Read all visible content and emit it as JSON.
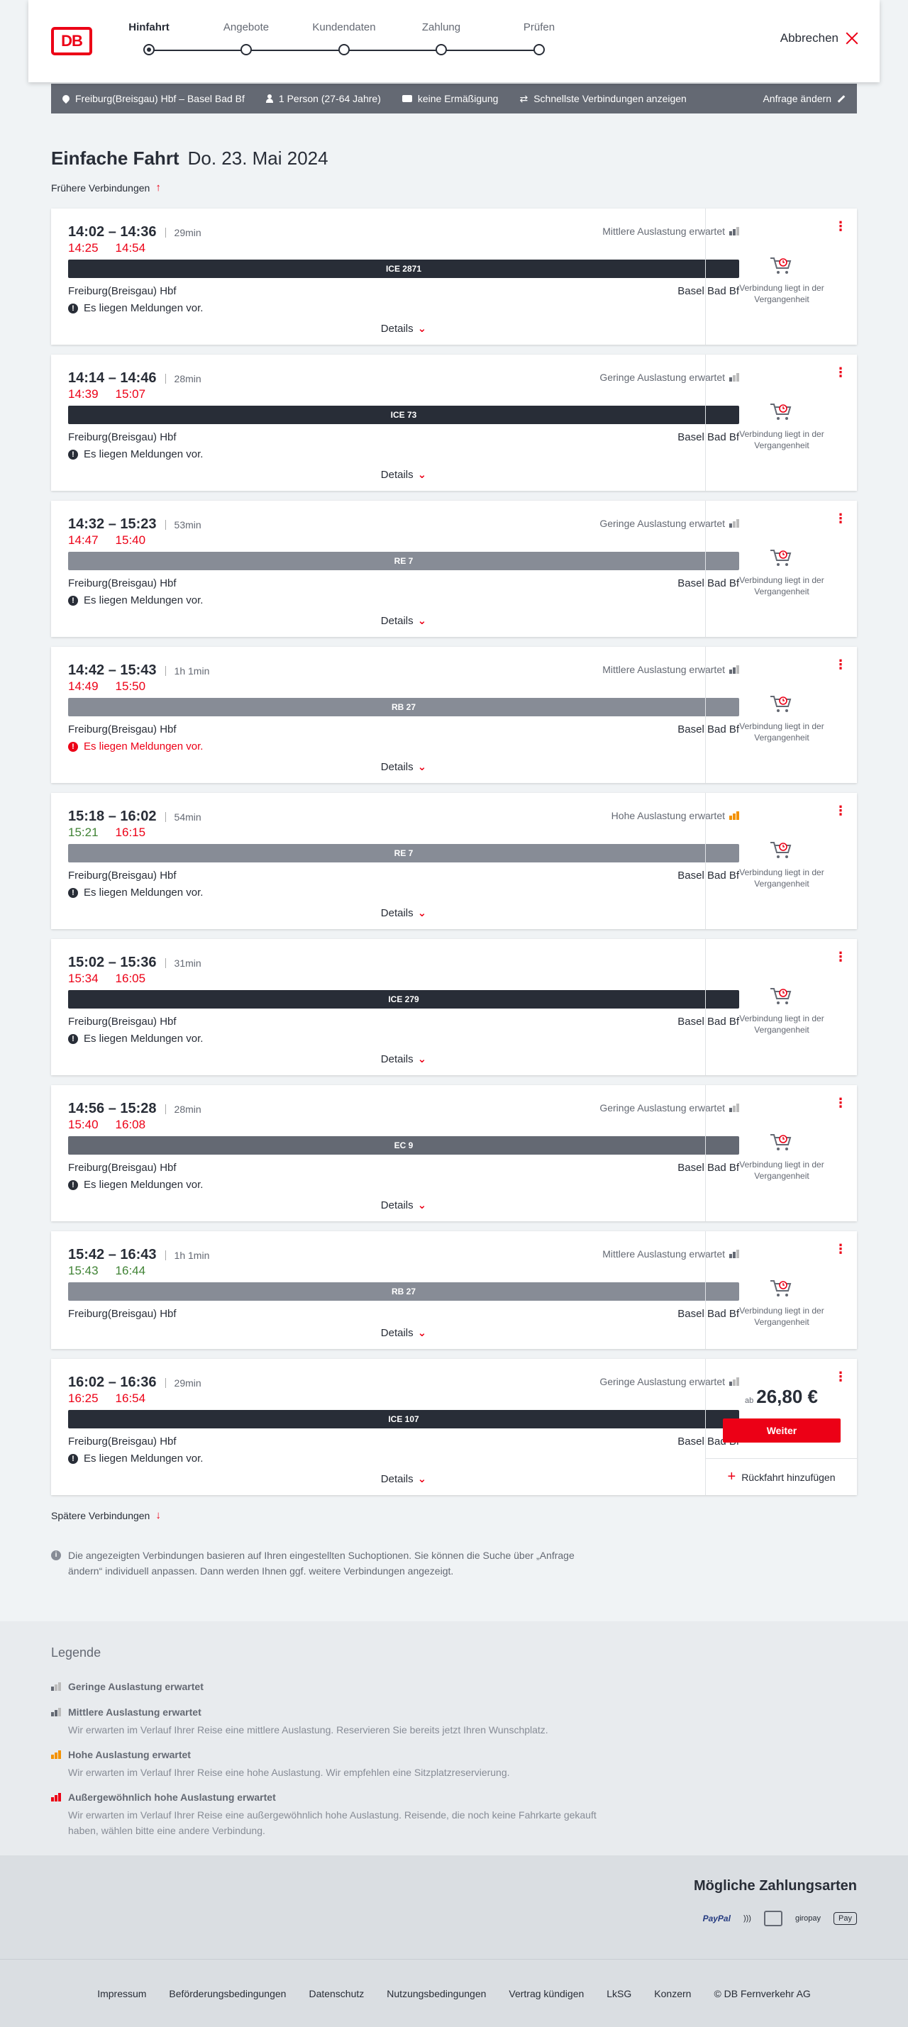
{
  "header": {
    "logo": "DB",
    "steps": [
      "Hinfahrt",
      "Angebote",
      "Kundendaten",
      "Zahlung",
      "Prüfen"
    ],
    "cancel": "Abbrechen"
  },
  "summary": {
    "route": "Freiburg(Breisgau) Hbf – Basel Bad Bf",
    "persons": "1 Person (27-64 Jahre)",
    "discount": "keine Ermäßigung",
    "fastest": "Schnellste Verbindungen anzeigen",
    "change": "Anfrage ändern"
  },
  "page": {
    "title": "Einfache Fahrt",
    "date": "Do. 23. Mai 2024",
    "earlier": "Frühere Verbindungen",
    "later": "Spätere Verbindungen",
    "info": "Die angezeigten Verbindungen basieren auf Ihren eingestellten Suchoptionen. Sie können die Suche über „Anfrage ändern“ individuell anpassen. Dann werden Ihnen ggf. weitere Verbindungen angezeigt."
  },
  "common": {
    "from": "Freiburg(Breisgau) Hbf",
    "to": "Basel Bad Bf",
    "details": "Details",
    "past": "Verbindung liegt in der Vergangenheit",
    "message": "Es liegen Meldungen vor.",
    "price_prefix": "ab",
    "weiter": "Weiter",
    "rueckfahrt": "Rückfahrt hinzufügen"
  },
  "connections": [
    {
      "times": "14:02 – 14:36",
      "duration": "29min",
      "rt_dep": "14:25",
      "rt_arr": "14:54",
      "rt_dep_status": "late",
      "rt_arr_status": "late",
      "load": "Mittlere Auslastung erwartet",
      "train": "ICE 2871",
      "train_type": "ice",
      "message": "Es liegen Meldungen vor.",
      "msg_red": false
    },
    {
      "times": "14:14 – 14:46",
      "duration": "28min",
      "rt_dep": "14:39",
      "rt_arr": "15:07",
      "rt_dep_status": "late",
      "rt_arr_status": "late",
      "load": "Geringe Auslastung erwartet",
      "train": "ICE 73",
      "train_type": "ice",
      "message": "Es liegen Meldungen vor.",
      "msg_red": false
    },
    {
      "times": "14:32 – 15:23",
      "duration": "53min",
      "rt_dep": "14:47",
      "rt_arr": "15:40",
      "rt_dep_status": "late",
      "rt_arr_status": "late",
      "load": "Geringe Auslastung erwartet",
      "train": "RE 7",
      "train_type": "re",
      "message": "Es liegen Meldungen vor.",
      "msg_red": false
    },
    {
      "times": "14:42 – 15:43",
      "duration": "1h 1min",
      "rt_dep": "14:49",
      "rt_arr": "15:50",
      "rt_dep_status": "late",
      "rt_arr_status": "late",
      "load": "Mittlere Auslastung erwartet",
      "train": "RB 27",
      "train_type": "re",
      "message": "Es liegen Meldungen vor.",
      "msg_red": true
    },
    {
      "times": "15:18 – 16:02",
      "duration": "54min",
      "rt_dep": "15:21",
      "rt_arr": "16:15",
      "rt_dep_status": "ok",
      "rt_arr_status": "late",
      "load": "Hohe Auslastung erwartet",
      "train": "RE 7",
      "train_type": "re",
      "message": "Es liegen Meldungen vor.",
      "msg_red": false
    },
    {
      "times": "15:02 – 15:36",
      "duration": "31min",
      "rt_dep": "15:34",
      "rt_arr": "16:05",
      "rt_dep_status": "late",
      "rt_arr_status": "late",
      "load": "",
      "train": "ICE 279",
      "train_type": "ice",
      "message": "Es liegen Meldungen vor.",
      "msg_red": false
    },
    {
      "times": "14:56 – 15:28",
      "duration": "28min",
      "rt_dep": "15:40",
      "rt_arr": "16:08",
      "rt_dep_status": "late",
      "rt_arr_status": "late",
      "load": "Geringe Auslastung erwartet",
      "train": "EC 9",
      "train_type": "ec",
      "message": "Es liegen Meldungen vor.",
      "msg_red": false
    },
    {
      "times": "15:42 – 16:43",
      "duration": "1h 1min",
      "rt_dep": "15:43",
      "rt_arr": "16:44",
      "rt_dep_status": "ok",
      "rt_arr_status": "ok",
      "load": "Mittlere Auslastung erwartet",
      "train": "RB 27",
      "train_type": "re",
      "message": "",
      "msg_red": false
    },
    {
      "times": "16:02 – 16:36",
      "duration": "29min",
      "rt_dep": "16:25",
      "rt_arr": "16:54",
      "rt_dep_status": "late",
      "rt_arr_status": "late",
      "load": "Geringe Auslastung erwartet",
      "train": "ICE 107",
      "train_type": "ice",
      "message": "Es liegen Meldungen vor.",
      "msg_red": false,
      "price": "26,80 €"
    }
  ],
  "legend": {
    "title": "Legende",
    "items": [
      {
        "title": "Geringe Auslastung erwartet",
        "desc": ""
      },
      {
        "title": "Mittlere Auslastung erwartet",
        "desc": "Wir erwarten im Verlauf Ihrer Reise eine mittlere Auslastung. Reservieren Sie bereits jetzt Ihren Wunschplatz."
      },
      {
        "title": "Hohe Auslastung erwartet",
        "desc": "Wir erwarten im Verlauf Ihrer Reise eine hohe Auslastung. Wir empfehlen eine Sitzplatzreservierung."
      },
      {
        "title": "Außergewöhnlich hohe Auslastung erwartet",
        "desc": "Wir erwarten im Verlauf Ihrer Reise eine außergewöhnlich hohe Auslastung. Reisende, die noch keine Fahrkarte gekauft haben, wählen bitte eine andere Verbindung."
      }
    ]
  },
  "payment": {
    "title": "Mögliche Zahlungsarten",
    "methods": [
      "PayPal",
      "giropay",
      "Pay"
    ]
  },
  "footer": [
    "Impressum",
    "Beförderungsbedingungen",
    "Datenschutz",
    "Nutzungsbedingungen",
    "Vertrag kündigen",
    "LkSG",
    "Konzern",
    "© DB Fernverkehr AG"
  ],
  "colors": {
    "accent": "#ec0016",
    "ok": "#408335",
    "dark": "#282d37"
  }
}
